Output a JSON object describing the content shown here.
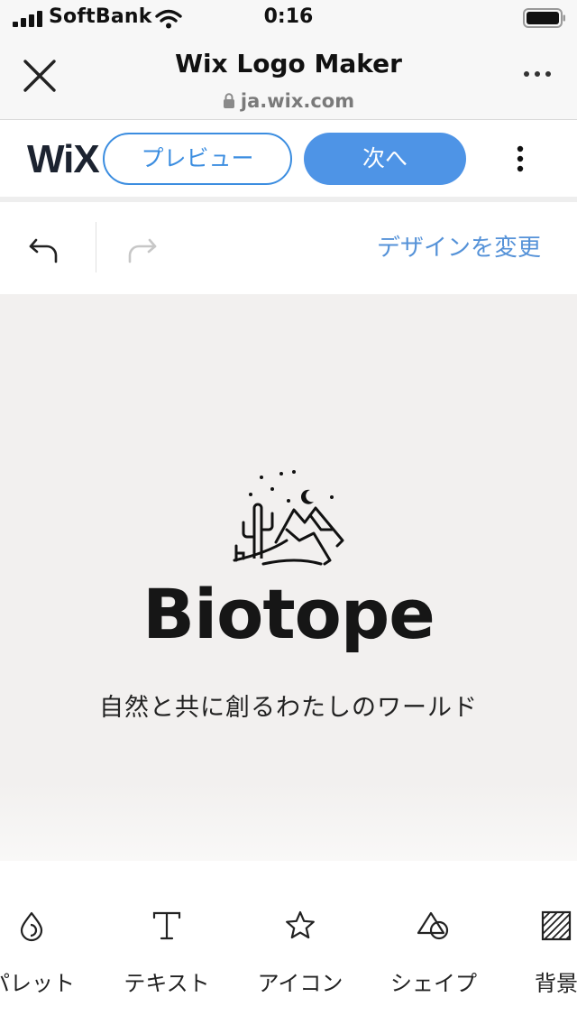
{
  "status_bar": {
    "carrier": "SoftBank",
    "time": "0:16"
  },
  "browser": {
    "title": "Wix Logo Maker",
    "url": "ja.wix.com"
  },
  "wix_bar": {
    "logo_text": "WiX",
    "preview_label": "プレビュー",
    "next_label": "次へ"
  },
  "edit_bar": {
    "change_design_label": "デザインを変更"
  },
  "canvas": {
    "brand_name": "Biotope",
    "tagline": "自然と共に創るわたしのワールド"
  },
  "tools": [
    {
      "label": "パレット",
      "icon": "palette-drop-icon"
    },
    {
      "label": "テキスト",
      "icon": "text-icon"
    },
    {
      "label": "アイコン",
      "icon": "star-icon"
    },
    {
      "label": "シェイプ",
      "icon": "shapes-icon"
    },
    {
      "label": "背景",
      "icon": "background-hatch-icon"
    }
  ],
  "colors": {
    "accent_blue": "#4e94e6",
    "link_blue": "#5592d8",
    "canvas_bg": "#f2f0ef"
  }
}
